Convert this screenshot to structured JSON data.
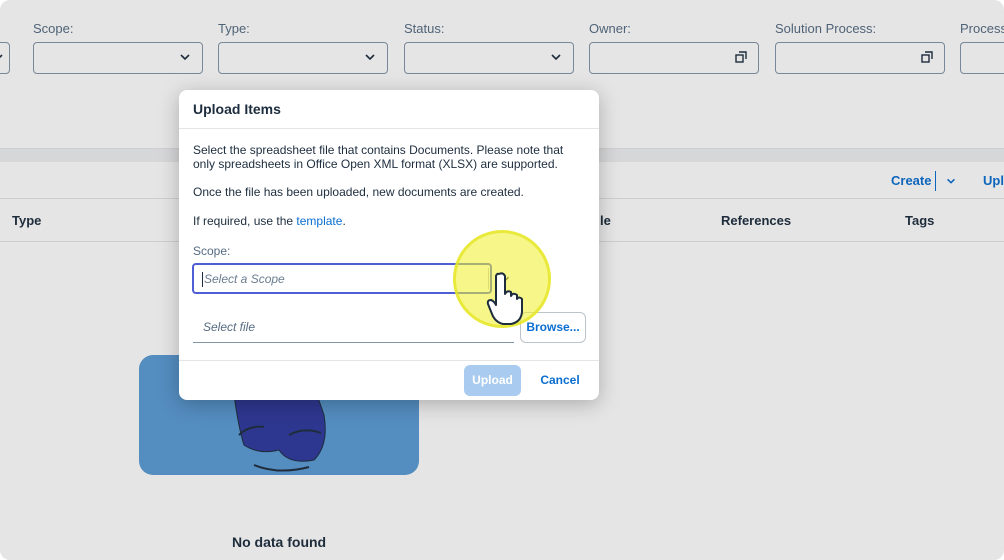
{
  "filters": [
    {
      "label": "Scope:",
      "kind": "select"
    },
    {
      "label": "Type:",
      "kind": "select"
    },
    {
      "label": "Status:",
      "kind": "select"
    },
    {
      "label": "Owner:",
      "kind": "valuehelp"
    },
    {
      "label": "Solution Process:",
      "kind": "valuehelp"
    },
    {
      "label": "Process",
      "kind": "valuehelp"
    }
  ],
  "toolbar": {
    "create_label": "Create",
    "upload_label": "Upl"
  },
  "table": {
    "columns": [
      "Type",
      "le",
      "References",
      "Tags"
    ]
  },
  "empty_state": {
    "text": "No data found"
  },
  "dialog": {
    "title": "Upload Items",
    "line1": "Select the spreadsheet file that contains Documents. Please note that",
    "line2": "only spreadsheets in Office Open XML format (XLSX) are supported.",
    "line3": "Once the file has been uploaded, new documents are created.",
    "template_prefix": "If required, use the ",
    "template_link": "template",
    "template_suffix": ".",
    "scope_label": "Scope:",
    "scope_placeholder": "Select a Scope",
    "file_placeholder": "Select file",
    "browse_label": "Browse...",
    "upload_label": "Upload",
    "cancel_label": "Cancel"
  },
  "colors": {
    "accent": "#0a6ed1",
    "focus": "#4e5ed4",
    "upload_disabled": "#a9cbf0"
  },
  "icons": {
    "chevron": "chevron-down-icon",
    "valuehelp": "value-help-icon",
    "cursor": "hand-pointer-icon"
  }
}
